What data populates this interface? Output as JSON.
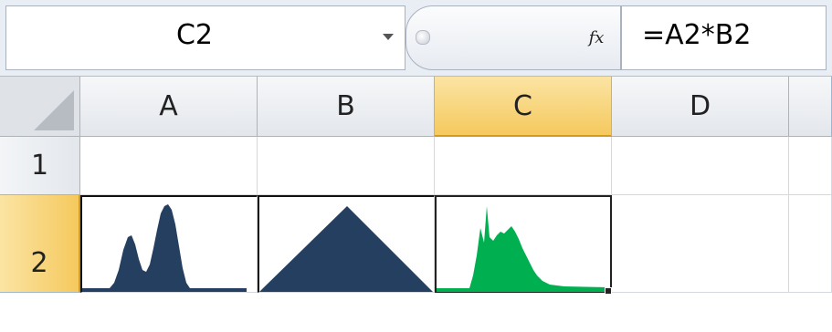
{
  "name_box": {
    "value": "C2"
  },
  "formula_bar": {
    "fx_label": "fx",
    "formula": "=A2*B2"
  },
  "columns": [
    {
      "label": "A",
      "selected": false
    },
    {
      "label": "B",
      "selected": false
    },
    {
      "label": "C",
      "selected": true
    },
    {
      "label": "D",
      "selected": false
    }
  ],
  "rows": [
    {
      "label": "1",
      "selected": false
    },
    {
      "label": "2",
      "selected": true
    }
  ],
  "active_cell": "C2",
  "colors": {
    "sparkline_a": "#243f60",
    "sparkline_b": "#243f60",
    "sparkline_c": "#00b050",
    "selection_highlight": "#f5c95e"
  },
  "cells": {
    "A2": {
      "sparkline": "bimodal-histogram"
    },
    "B2": {
      "sparkline": "triangle-histogram"
    },
    "C2": {
      "sparkline": "spiked-histogram",
      "formula": "=A2*B2"
    }
  }
}
